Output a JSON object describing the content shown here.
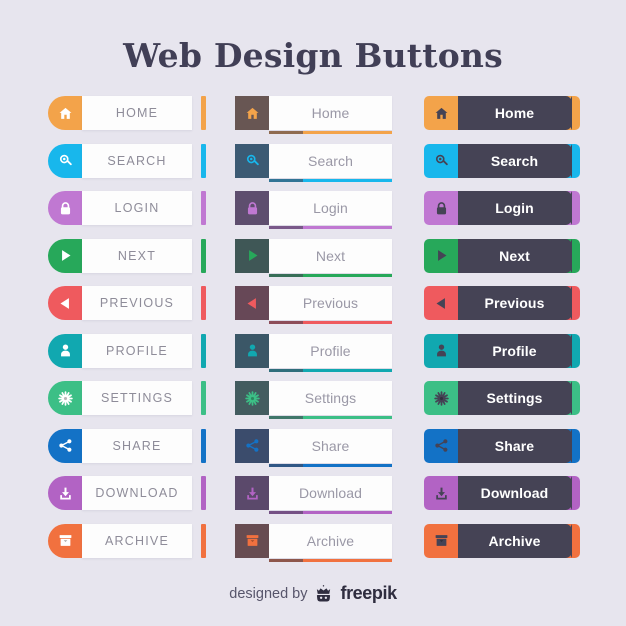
{
  "page": {
    "title": "Web Design Buttons",
    "background_color": "#e7e5ee"
  },
  "colors": {
    "home": "#f5a council",
    "title_text": "#413f56",
    "dark_body": "#454355",
    "light_body": "#fdfdfd",
    "light_label_text": "#8e8c99",
    "dark_label_text": "#ffffff"
  },
  "buttons": [
    {
      "id": "home",
      "icon": "home-icon",
      "accent": "#f3a34a",
      "label_upper": "HOME",
      "label_title": "Home"
    },
    {
      "id": "search",
      "icon": "search-icon",
      "accent": "#18b7ec",
      "label_upper": "SEARCH",
      "label_title": "Search"
    },
    {
      "id": "login",
      "icon": "lock-icon",
      "accent": "#c078d2",
      "label_upper": "LOGIN",
      "label_title": "Login"
    },
    {
      "id": "next",
      "icon": "play-icon",
      "accent": "#27a85a",
      "label_upper": "NEXT",
      "label_title": "Next"
    },
    {
      "id": "previous",
      "icon": "back-icon",
      "accent": "#ef5a5e",
      "label_upper": "PREVIOUS",
      "label_title": "Previous"
    },
    {
      "id": "profile",
      "icon": "person-icon",
      "accent": "#11a8b0",
      "label_upper": "PROFILE",
      "label_title": "Profile"
    },
    {
      "id": "settings",
      "icon": "gear-icon",
      "accent": "#3cbf86",
      "label_upper": "SETTINGS",
      "label_title": "Settings"
    },
    {
      "id": "share",
      "icon": "share-icon",
      "accent": "#1372c6",
      "label_upper": "SHARE",
      "label_title": "Share"
    },
    {
      "id": "download",
      "icon": "download-icon",
      "accent": "#b263c4",
      "label_upper": "DOWNLOAD",
      "label_title": "Download"
    },
    {
      "id": "archive",
      "icon": "archive-icon",
      "accent": "#f1713f",
      "label_upper": "ARCHIVE",
      "label_title": "Archive"
    }
  ],
  "columns": [
    {
      "id": "column-light-pill",
      "style": "pill-light",
      "label_case": "upper"
    },
    {
      "id": "column-dark-tile",
      "style": "tile-light",
      "label_case": "title"
    },
    {
      "id": "column-dark-ribbon",
      "style": "ribbon-dark",
      "label_case": "title"
    }
  ],
  "footer": {
    "designed_by": "designed by",
    "brand": "freepik",
    "logo_icon": "freepik-logo-icon"
  }
}
